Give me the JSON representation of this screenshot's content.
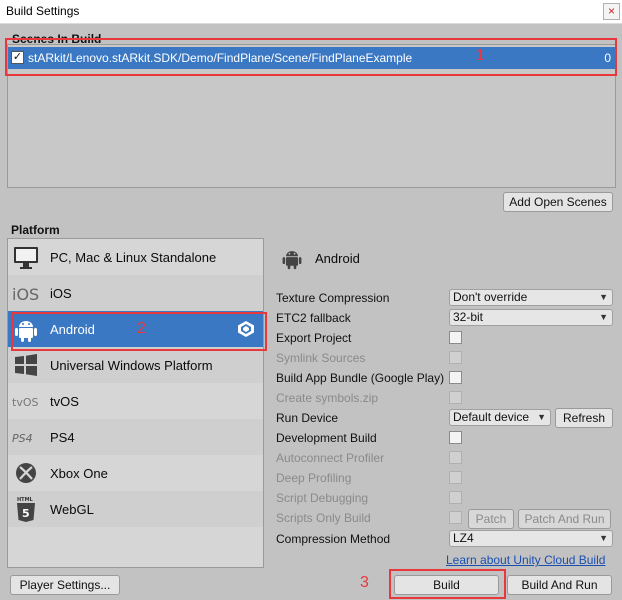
{
  "window": {
    "title": "Build Settings",
    "close_glyph": "×"
  },
  "scenes": {
    "header": "Scenes In Build",
    "items": [
      {
        "checked": true,
        "path": "stARkit/Lenovo.stARkit.SDK/Demo/FindPlane/Scene/FindPlaneExample",
        "index": "0"
      }
    ],
    "add_open_scenes": "Add Open Scenes"
  },
  "annotations": [
    "1",
    "2",
    "3"
  ],
  "platform": {
    "header": "Platform",
    "items": [
      {
        "name": "PC, Mac & Linux Standalone",
        "icon": "monitor-icon"
      },
      {
        "name": "iOS",
        "icon": "ios-icon"
      },
      {
        "name": "Android",
        "icon": "android-icon",
        "selected": true
      },
      {
        "name": "Universal Windows Platform",
        "icon": "windows-icon"
      },
      {
        "name": "tvOS",
        "icon": "tvos-icon"
      },
      {
        "name": "PS4",
        "icon": "ps4-icon"
      },
      {
        "name": "Xbox One",
        "icon": "xbox-icon"
      },
      {
        "name": "WebGL",
        "icon": "html5-icon"
      }
    ]
  },
  "settings": {
    "title": "Android",
    "texture_compression": {
      "label": "Texture Compression",
      "value": "Don't override"
    },
    "etc2_fallback": {
      "label": "ETC2 fallback",
      "value": "32-bit"
    },
    "export_project": "Export Project",
    "symlink_sources": "Symlink Sources",
    "build_app_bundle": "Build App Bundle (Google Play)",
    "create_symbols": "Create symbols.zip",
    "run_device": {
      "label": "Run Device",
      "value": "Default device",
      "refresh": "Refresh"
    },
    "development_build": "Development Build",
    "autoconnect_profiler": "Autoconnect Profiler",
    "deep_profiling": "Deep Profiling",
    "script_debugging": "Script Debugging",
    "scripts_only_build": {
      "label": "Scripts Only Build",
      "patch": "Patch",
      "patch_and_run": "Patch And Run"
    },
    "compression_method": {
      "label": "Compression Method",
      "value": "LZ4"
    },
    "cloud_build_link": "Learn about Unity Cloud Build"
  },
  "footer": {
    "player_settings": "Player Settings...",
    "build": "Build",
    "build_and_run": "Build And Run"
  },
  "colors": {
    "selection": "#3b78c4",
    "annotation": "#e8383e",
    "link": "#1a4fb0"
  }
}
